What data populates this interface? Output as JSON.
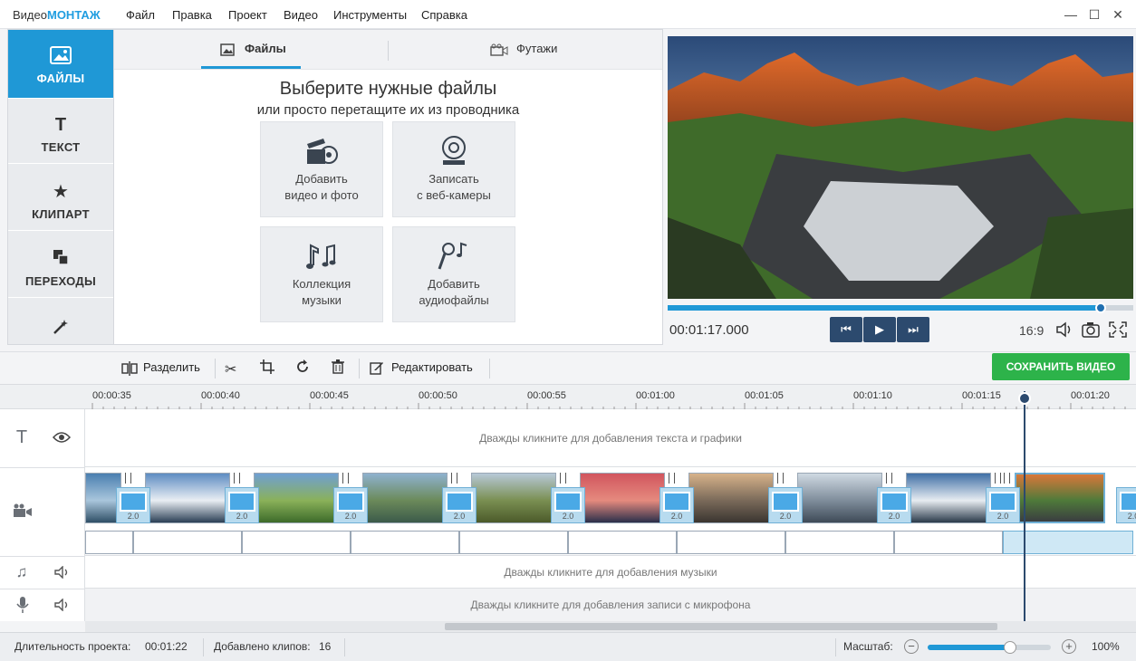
{
  "app": {
    "title_prefix": "Видео",
    "title_brand": "МОНТАЖ",
    "accent": "#1f98d6"
  },
  "menu": [
    "Файл",
    "Правка",
    "Проект",
    "Видео",
    "Инструменты",
    "Справка"
  ],
  "window_controls": {
    "minimize": "—",
    "maximize": "☐",
    "close": "✕"
  },
  "sidebar": {
    "items": [
      {
        "label": "ФАЙЛЫ",
        "icon": "image-icon",
        "active": true
      },
      {
        "label": "ТЕКСТ",
        "icon": "text-icon"
      },
      {
        "label": "КЛИПАРТ",
        "icon": "star-icon"
      },
      {
        "label": "ПЕРЕХОДЫ",
        "icon": "transitions-icon"
      },
      {
        "label": "",
        "icon": "magic-wand-icon"
      }
    ]
  },
  "files": {
    "tabs": {
      "files": "Файлы",
      "footage": "Футажи"
    },
    "heading": "Выберите нужные файлы",
    "subheading": "или просто перетащите их из проводника",
    "tiles": [
      {
        "line1": "Добавить",
        "line2": "видео и фото",
        "icon": "film-camera-icon"
      },
      {
        "line1": "Записать",
        "line2": "с веб-камеры",
        "icon": "webcam-icon"
      },
      {
        "line1": "Коллекция",
        "line2": "музыки",
        "icon": "music-notes-icon"
      },
      {
        "line1": "Добавить",
        "line2": "аудиофайлы",
        "icon": "microphone-icon"
      }
    ]
  },
  "player": {
    "timecode": "00:01:17.000",
    "aspect": "16:9",
    "progress": 0.93
  },
  "toolbar": {
    "split": "Разделить",
    "edit": "Редактировать",
    "save": "СОХРАНИТЬ ВИДЕО"
  },
  "timeline": {
    "ticks": [
      "00:00:35",
      "00:00:40",
      "00:00:45",
      "00:00:50",
      "00:00:55",
      "00:01:00",
      "00:01:05",
      "00:01:10",
      "00:01:15",
      "00:01:20"
    ],
    "text_hint": "Дважды кликните для добавления текста и графики",
    "music_hint": "Дважды кликните для добавления музыки",
    "mic_hint": "Дважды кликните для добавления записи с микрофона",
    "transition_label": "2.0"
  },
  "status": {
    "duration_label": "Длительность проекта:",
    "duration_value": "00:01:22",
    "clips_label": "Добавлено клипов:",
    "clips_value": "16",
    "scale_label": "Масштаб:",
    "zoom_percent": "100%",
    "zoom_level": 0.67
  }
}
